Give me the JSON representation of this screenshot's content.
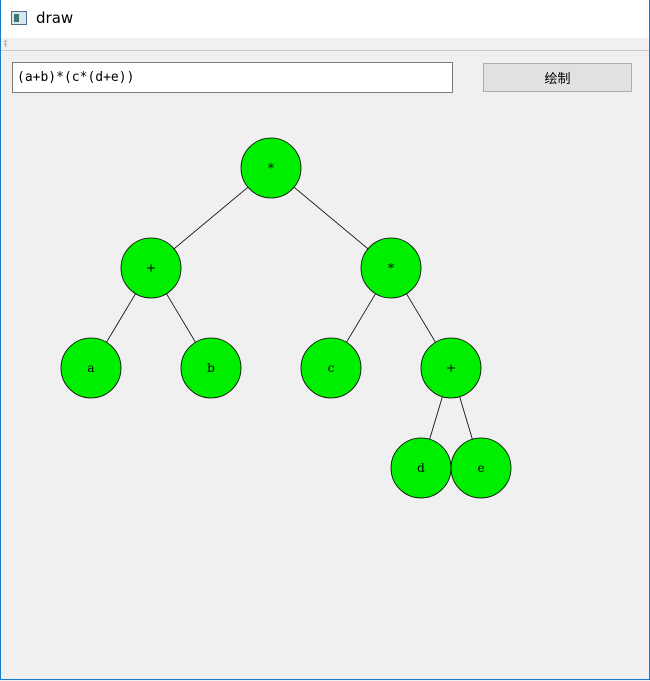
{
  "window": {
    "title": "draw"
  },
  "input": {
    "value": "(a+b)*(c*(d+e))"
  },
  "button": {
    "label": "绘制"
  },
  "tree": {
    "node_color": "#00ee00",
    "nodes": [
      {
        "id": "n1",
        "label": "*"
      },
      {
        "id": "n2",
        "label": "+"
      },
      {
        "id": "n3",
        "label": "*"
      },
      {
        "id": "n4",
        "label": "a"
      },
      {
        "id": "n5",
        "label": "b"
      },
      {
        "id": "n6",
        "label": "c"
      },
      {
        "id": "n7",
        "label": "+"
      },
      {
        "id": "n8",
        "label": "d"
      },
      {
        "id": "n9",
        "label": "e"
      }
    ],
    "edges": [
      [
        "n1",
        "n2"
      ],
      [
        "n1",
        "n3"
      ],
      [
        "n2",
        "n4"
      ],
      [
        "n2",
        "n5"
      ],
      [
        "n3",
        "n6"
      ],
      [
        "n3",
        "n7"
      ],
      [
        "n7",
        "n8"
      ],
      [
        "n7",
        "n9"
      ]
    ]
  }
}
